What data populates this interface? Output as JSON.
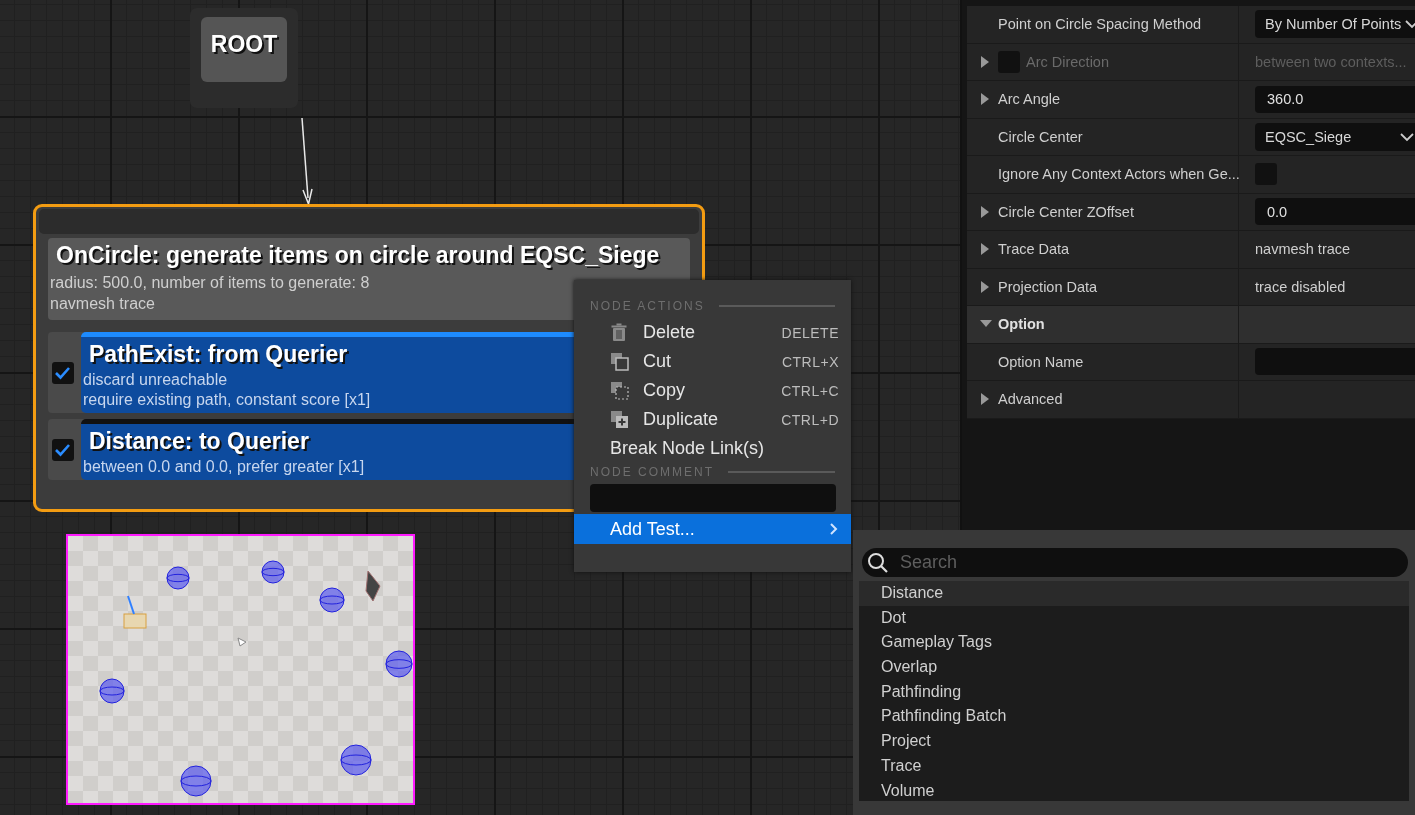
{
  "graph": {
    "root_node": {
      "label": "ROOT"
    },
    "generator_node": {
      "selected": true,
      "title": "OnCircle: generate items on circle around EQSC_Siege",
      "details": [
        "radius: 500.0, number of items to generate: 8",
        "navmesh trace"
      ],
      "tests": [
        {
          "title": "PathExist: from Querier",
          "enabled": true,
          "selected": true,
          "details": [
            "discard unreachable",
            "require existing path, constant score [x1]"
          ]
        },
        {
          "title": "Distance: to Querier",
          "enabled": true,
          "selected": false,
          "details": [
            "between 0.0 and 0.0, prefer greater [x1]"
          ]
        }
      ]
    }
  },
  "context_menu": {
    "sections": [
      {
        "kind": "actions",
        "title": "NODE ACTIONS",
        "items": [
          {
            "label": "Delete",
            "shortcut": "DELETE"
          },
          {
            "label": "Cut",
            "shortcut": "CTRL+X"
          },
          {
            "label": "Copy",
            "shortcut": "CTRL+C"
          },
          {
            "label": "Duplicate",
            "shortcut": "CTRL+D"
          },
          {
            "label": "Break Node Link(s)"
          }
        ]
      },
      {
        "kind": "comment",
        "title": "NODE COMMENT"
      }
    ],
    "submenu_item": {
      "label": "Add Test...",
      "selected": true
    }
  },
  "add_test_menu": {
    "search": {
      "placeholder": "Search"
    },
    "items": [
      {
        "label": "Distance",
        "selected": true
      },
      {
        "label": "Dot",
        "selected": false
      },
      {
        "label": "Gameplay Tags",
        "selected": false
      },
      {
        "label": "Overlap",
        "selected": false
      },
      {
        "label": "Pathfinding",
        "selected": false
      },
      {
        "label": "Pathfinding Batch",
        "selected": false
      },
      {
        "label": "Project",
        "selected": false
      },
      {
        "label": "Trace",
        "selected": false
      },
      {
        "label": "Volume",
        "selected": false
      }
    ]
  },
  "details_panel": {
    "rows": [
      {
        "kind": "dropdown",
        "label": "Point on Circle Spacing Method",
        "value": "By Number Of Points",
        "expandable": false,
        "disabled": false
      },
      {
        "kind": "text",
        "label": "Arc Direction",
        "value": "between two contexts...",
        "expandable": true,
        "expanded": false,
        "disabled": true,
        "checked": false
      },
      {
        "kind": "number",
        "label": "Arc Angle",
        "value": "360.0",
        "expandable": true,
        "expanded": false,
        "disabled": false
      },
      {
        "kind": "dropdown",
        "label": "Circle Center",
        "value": "EQSC_Siege",
        "expandable": false,
        "disabled": false
      },
      {
        "kind": "checkbox",
        "label": "Ignore Any Context Actors when Ge...",
        "checked": false,
        "expandable": false,
        "disabled": false
      },
      {
        "kind": "number",
        "label": "Circle Center ZOffset",
        "value": "0.0",
        "expandable": true,
        "expanded": false,
        "disabled": false
      },
      {
        "kind": "text",
        "label": "Trace Data",
        "value": "navmesh trace",
        "expandable": true,
        "expanded": false,
        "disabled": false
      },
      {
        "kind": "text",
        "label": "Projection Data",
        "value": "trace disabled",
        "expandable": true,
        "expanded": false,
        "disabled": false
      },
      {
        "kind": "category",
        "label": "Option",
        "expandable": true,
        "expanded": true,
        "disabled": false
      },
      {
        "kind": "input",
        "label": "Option Name",
        "expandable": false,
        "disabled": false
      },
      {
        "kind": "none",
        "label": "Advanced",
        "expandable": true,
        "expanded": false,
        "disabled": false
      }
    ]
  }
}
